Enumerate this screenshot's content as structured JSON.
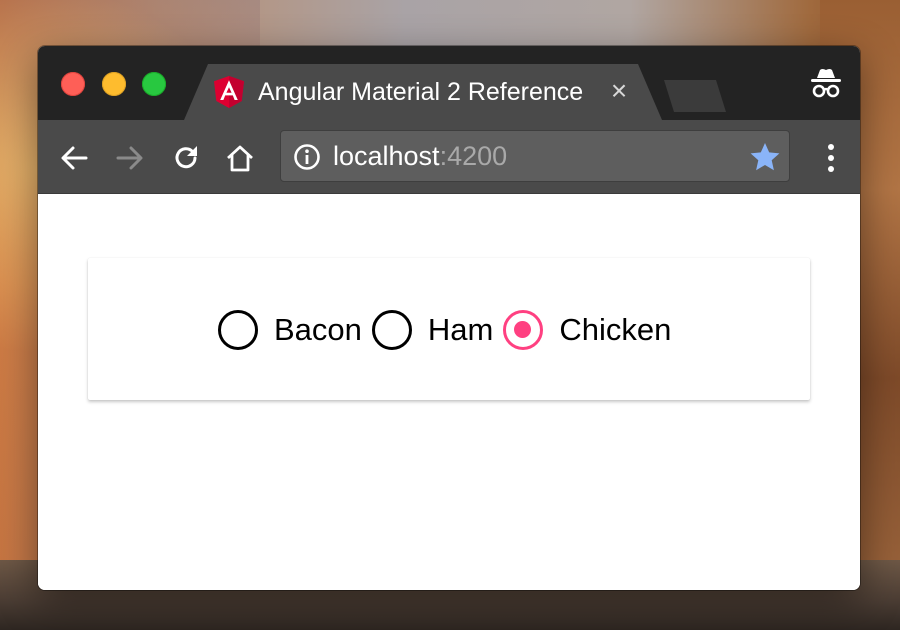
{
  "browser": {
    "tab": {
      "title": "Angular Material 2 Reference",
      "close_symbol": "×",
      "favicon": "angular-logo-icon"
    },
    "address_bar": {
      "host": "localhost",
      "port": ":4200"
    },
    "toolbar_icons": [
      "back-arrow-icon",
      "forward-arrow-icon",
      "reload-icon",
      "home-icon",
      "info-icon",
      "bookmark-star-icon",
      "menu-icon"
    ],
    "mode_icon": "incognito-icon"
  },
  "radio_group": {
    "options": [
      {
        "label": "Bacon",
        "checked": false
      },
      {
        "label": "Ham",
        "checked": false
      },
      {
        "label": "Chicken",
        "checked": true
      }
    ]
  },
  "colors": {
    "accent_pink": "#ff4081",
    "star_blue": "#8ab4f8",
    "angular_red": "#dd0031"
  }
}
